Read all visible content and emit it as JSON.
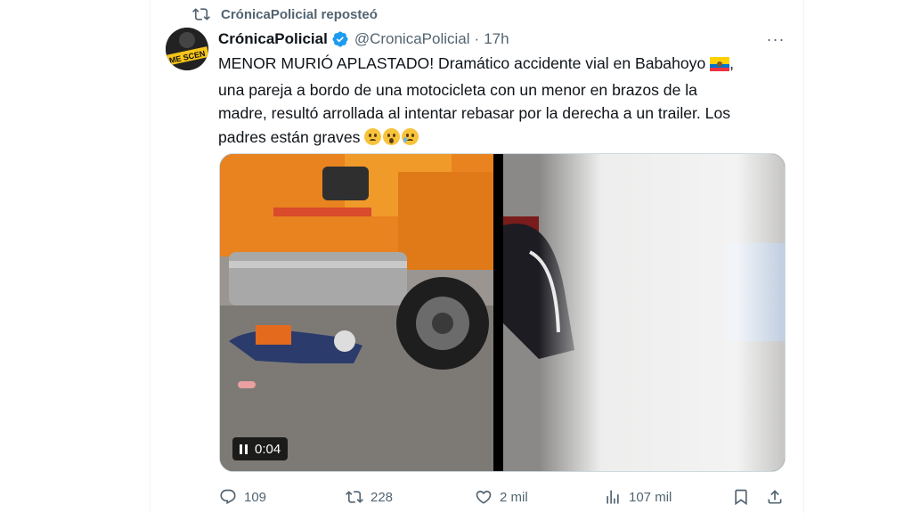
{
  "repost": {
    "text": "CrónicaPolicial reposteó",
    "icon": "repost-icon"
  },
  "author": {
    "name": "CrónicaPolicial",
    "handle": "@CronicaPolicial",
    "separator": "·",
    "time": "17h",
    "verified": true,
    "avatar_text": "ME SCEN"
  },
  "more_label": "···",
  "tweet": {
    "line1": "MENOR MURIÓ APLASTADO! Dramático accidente vial en Babahoyo",
    "line1_tail": ",",
    "line2": "una pareja a bordo de una motocicleta con un menor en brazos de la",
    "line3": "madre, resultó arrollada al intentar rebasar por la derecha a un trailer.  Los",
    "line4": "padres están graves",
    "flag": "ecuador-flag",
    "emojis": [
      "worried-face",
      "hushed-face",
      "sad-relieved-face"
    ]
  },
  "media": {
    "video_time": "0:04",
    "left_description_icon": "video-thumbnail",
    "right_description_icon": "blurred-image"
  },
  "actions": {
    "replies": "109",
    "reposts": "228",
    "likes": "2 mil",
    "views": "107 mil"
  },
  "colors": {
    "text": "#0f1419",
    "secondary": "#536471",
    "verified": "#1d9bf0",
    "border": "#eff3f4"
  }
}
